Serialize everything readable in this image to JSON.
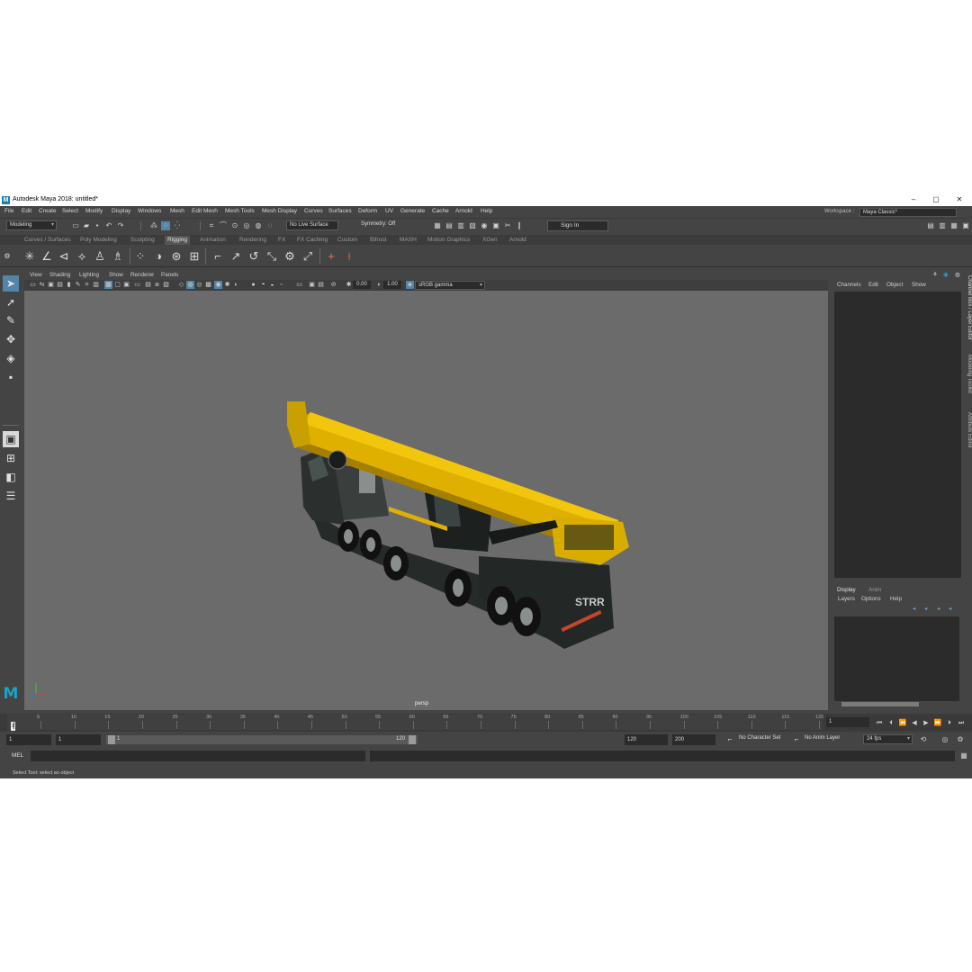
{
  "window": {
    "title": "Autodesk Maya 2018: untitled*",
    "logo": "M",
    "minimize": "–",
    "maximize": "▢",
    "close": "✕"
  },
  "menu": [
    "File",
    "Edit",
    "Create",
    "Select",
    "Modify",
    "Display",
    "Windows",
    "Mesh",
    "Edit Mesh",
    "Mesh Tools",
    "Mesh Display",
    "Curves",
    "Surfaces",
    "Deform",
    "UV",
    "Generate",
    "Cache",
    "Arnold",
    "Help"
  ],
  "workspace": {
    "label": "Workspace :",
    "value": "Maya Classic*"
  },
  "status_line": {
    "menu_set": "Modeling",
    "live_surface": "No Live Surface",
    "symmetry": "Symmetry: Off",
    "sign_in": "Sign In"
  },
  "shelf_tabs": [
    "Curves / Surfaces",
    "Poly Modeling",
    "Sculpting",
    "Rigging",
    "Animation",
    "Rendering",
    "FX",
    "FX Caching",
    "Custom",
    "Bifrost",
    "MASH",
    "Motion Graphics",
    "XGen",
    "Arnold"
  ],
  "active_shelf": "Rigging",
  "viewport": {
    "menu": [
      "View",
      "Shading",
      "Lighting",
      "Show",
      "Renderer",
      "Panels"
    ],
    "exposure": "0.00",
    "gamma": "1.00",
    "color_space": "sRGB gamma",
    "camera": "persp",
    "plate_text": "STRR"
  },
  "channel_box": {
    "menu": [
      "Channels",
      "Edit",
      "Object",
      "Show"
    ]
  },
  "layer_editor": {
    "tabs": [
      "Display",
      "Anim"
    ],
    "menu": [
      "Layers",
      "Options",
      "Help"
    ]
  },
  "side_tabs": [
    "Channel Box / Layer Editor",
    "Modeling Toolkit",
    "Attribute Editor"
  ],
  "time_slider": {
    "ticks": [
      "1",
      "5",
      "10",
      "15",
      "20",
      "25",
      "30",
      "35",
      "40",
      "45",
      "50",
      "55",
      "60",
      "65",
      "70",
      "75",
      "80",
      "85",
      "90",
      "95",
      "100",
      "105",
      "110",
      "115",
      "120"
    ],
    "current_frame": "1",
    "current_frame_field": "1"
  },
  "range": {
    "start": "1",
    "playback_start": "1",
    "slider_start": "1",
    "slider_end": "120",
    "playback_end": "120",
    "end": "200",
    "character_set": "No Character Set",
    "anim_layer": "No Anim Layer",
    "fps": "24 fps"
  },
  "command_line": {
    "label": "MEL"
  },
  "help_line": "Select Tool: select an object"
}
